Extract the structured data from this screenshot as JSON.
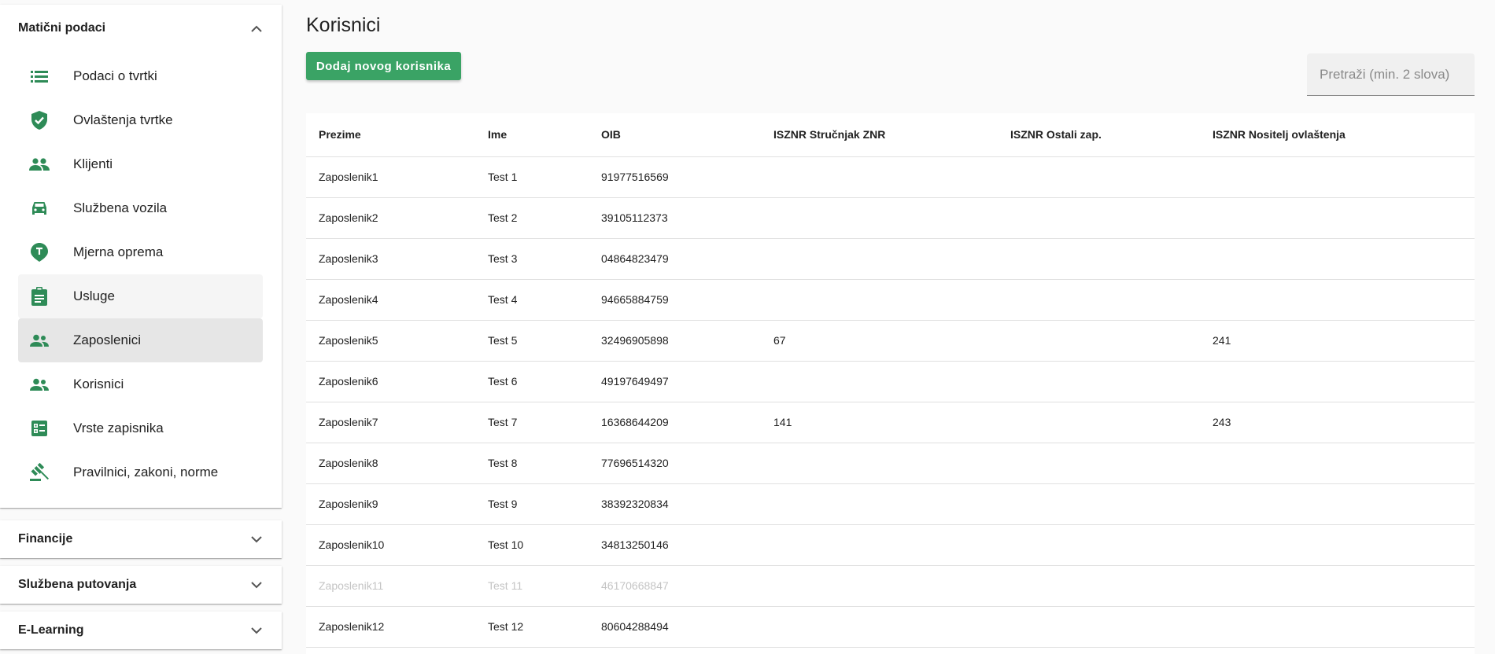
{
  "sidebar": {
    "sections": [
      {
        "title": "Matični podaci",
        "expanded": true,
        "items": [
          {
            "label": "Podaci o tvrtki",
            "icon": "list-icon"
          },
          {
            "label": "Ovlaštenja tvrtke",
            "icon": "verified-shield-icon"
          },
          {
            "label": "Klijenti",
            "icon": "people-icon"
          },
          {
            "label": "Službena vozila",
            "icon": "car-icon"
          },
          {
            "label": "Mjerna oprema",
            "icon": "measurement-pin-icon"
          },
          {
            "label": "Usluge",
            "icon": "clipboard-icon"
          },
          {
            "label": "Zaposlenici",
            "icon": "supervisor-icon"
          },
          {
            "label": "Korisnici",
            "icon": "supervisor-icon"
          },
          {
            "label": "Vrste zapisnika",
            "icon": "list-alt-icon"
          },
          {
            "label": "Pravilnici, zakoni, norme",
            "icon": "gavel-icon"
          }
        ]
      },
      {
        "title": "Financije",
        "expanded": false
      },
      {
        "title": "Službena putovanja",
        "expanded": false
      },
      {
        "title": "E-Learning",
        "expanded": false
      }
    ]
  },
  "main": {
    "title": "Korisnici",
    "add_button_label": "Dodaj novog korisnika",
    "search_placeholder": "Pretraži (min. 2 slova)"
  },
  "table": {
    "columns": [
      "Prezime",
      "Ime",
      "OIB",
      "ISZNR Stručnjak ZNR",
      "ISZNR Ostali zap.",
      "ISZNR Nositelj ovlaštenja"
    ],
    "rows": [
      [
        "Zaposlenik1",
        "Test 1",
        "91977516569",
        "",
        "",
        ""
      ],
      [
        "Zaposlenik2",
        "Test 2",
        "39105112373",
        "",
        "",
        ""
      ],
      [
        "Zaposlenik3",
        "Test 3",
        "04864823479",
        "",
        "",
        ""
      ],
      [
        "Zaposlenik4",
        "Test 4",
        "94665884759",
        "",
        "",
        ""
      ],
      [
        "Zaposlenik5",
        "Test 5",
        "32496905898",
        "67",
        "",
        "241"
      ],
      [
        "Zaposlenik6",
        "Test 6",
        "49197649497",
        "",
        "",
        ""
      ],
      [
        "Zaposlenik7",
        "Test 7",
        "16368644209",
        "141",
        "",
        "243"
      ],
      [
        "Zaposlenik8",
        "Test 8",
        "77696514320",
        "",
        "",
        ""
      ],
      [
        "Zaposlenik9",
        "Test 9",
        "38392320834",
        "",
        "",
        ""
      ],
      [
        "Zaposlenik10",
        "Test 10",
        "34813250146",
        "",
        "",
        ""
      ],
      [
        "Zaposlenik11",
        "Test 11",
        "46170668847",
        "",
        "",
        ""
      ],
      [
        "Zaposlenik12",
        "Test 12",
        "80604288494",
        "",
        "",
        ""
      ]
    ]
  },
  "colors": {
    "accent": "#3aa365",
    "icon": "#2e8b57",
    "active_item_bg": "#e6e6e6",
    "hover_item_bg": "#f5f5f5"
  }
}
